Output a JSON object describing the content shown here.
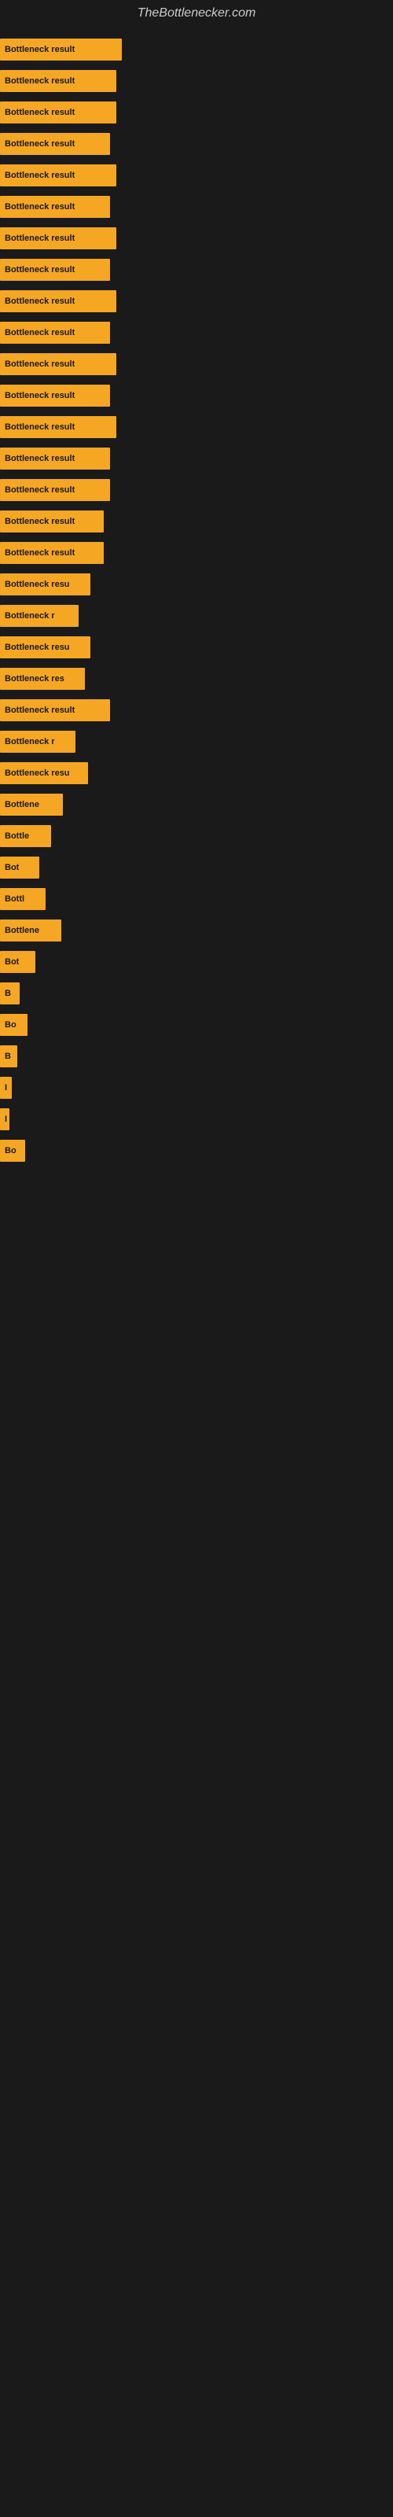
{
  "site": {
    "title": "TheBottlenecker.com"
  },
  "bars": [
    {
      "id": 1,
      "label": "Bottleneck result",
      "width": 155
    },
    {
      "id": 2,
      "label": "Bottleneck result",
      "width": 148
    },
    {
      "id": 3,
      "label": "Bottleneck result",
      "width": 148
    },
    {
      "id": 4,
      "label": "Bottleneck result",
      "width": 140
    },
    {
      "id": 5,
      "label": "Bottleneck result",
      "width": 148
    },
    {
      "id": 6,
      "label": "Bottleneck result",
      "width": 140
    },
    {
      "id": 7,
      "label": "Bottleneck result",
      "width": 148
    },
    {
      "id": 8,
      "label": "Bottleneck result",
      "width": 140
    },
    {
      "id": 9,
      "label": "Bottleneck result",
      "width": 148
    },
    {
      "id": 10,
      "label": "Bottleneck result",
      "width": 140
    },
    {
      "id": 11,
      "label": "Bottleneck result",
      "width": 148
    },
    {
      "id": 12,
      "label": "Bottleneck result",
      "width": 140
    },
    {
      "id": 13,
      "label": "Bottleneck result",
      "width": 148
    },
    {
      "id": 14,
      "label": "Bottleneck result",
      "width": 140
    },
    {
      "id": 15,
      "label": "Bottleneck result",
      "width": 140
    },
    {
      "id": 16,
      "label": "Bottleneck result",
      "width": 132
    },
    {
      "id": 17,
      "label": "Bottleneck result",
      "width": 132
    },
    {
      "id": 18,
      "label": "Bottleneck resu",
      "width": 115
    },
    {
      "id": 19,
      "label": "Bottleneck r",
      "width": 100
    },
    {
      "id": 20,
      "label": "Bottleneck resu",
      "width": 115
    },
    {
      "id": 21,
      "label": "Bottleneck res",
      "width": 108
    },
    {
      "id": 22,
      "label": "Bottleneck result",
      "width": 140
    },
    {
      "id": 23,
      "label": "Bottleneck r",
      "width": 96
    },
    {
      "id": 24,
      "label": "Bottleneck resu",
      "width": 112
    },
    {
      "id": 25,
      "label": "Bottlene",
      "width": 80
    },
    {
      "id": 26,
      "label": "Bottle",
      "width": 65
    },
    {
      "id": 27,
      "label": "Bot",
      "width": 50
    },
    {
      "id": 28,
      "label": "Bottl",
      "width": 58
    },
    {
      "id": 29,
      "label": "Bottlene",
      "width": 78
    },
    {
      "id": 30,
      "label": "Bot",
      "width": 45
    },
    {
      "id": 31,
      "label": "B",
      "width": 25
    },
    {
      "id": 32,
      "label": "Bo",
      "width": 35
    },
    {
      "id": 33,
      "label": "B",
      "width": 22
    },
    {
      "id": 34,
      "label": "I",
      "width": 15
    },
    {
      "id": 35,
      "label": "I",
      "width": 12
    },
    {
      "id": 36,
      "label": "Bo",
      "width": 32
    }
  ]
}
